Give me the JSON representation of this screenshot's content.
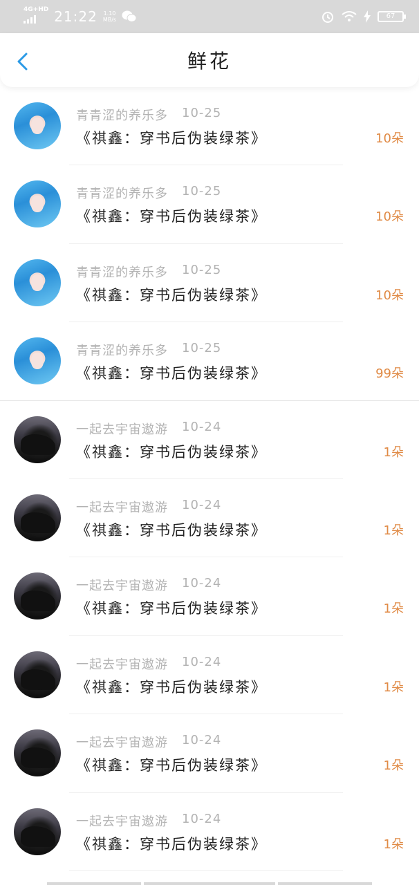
{
  "status_bar": {
    "network": "4G+HD",
    "time": "21:22",
    "speed_value": "1.10",
    "speed_unit": "MB/s",
    "battery": "67"
  },
  "header": {
    "title": "鲜花"
  },
  "rows": [
    {
      "name": "青青涩的养乐多",
      "date": "10-25",
      "book": "《祺鑫：穿书后伪装绿茶》",
      "count": "10朵",
      "avatar": "girl-blue-hair"
    },
    {
      "name": "青青涩的养乐多",
      "date": "10-25",
      "book": "《祺鑫：穿书后伪装绿茶》",
      "count": "10朵",
      "avatar": "girl-blue-hair"
    },
    {
      "name": "青青涩的养乐多",
      "date": "10-25",
      "book": "《祺鑫：穿书后伪装绿茶》",
      "count": "10朵",
      "avatar": "girl-blue-hair"
    },
    {
      "name": "青青涩的养乐多",
      "date": "10-25",
      "book": "《祺鑫：穿书后伪装绿茶》",
      "count": "99朵",
      "avatar": "girl-blue-hair"
    },
    {
      "name": "一起去宇宙遨游",
      "date": "10-24",
      "book": "《祺鑫：穿书后伪装绿茶》",
      "count": "1朵",
      "avatar": "dark-tree"
    },
    {
      "name": "一起去宇宙遨游",
      "date": "10-24",
      "book": "《祺鑫：穿书后伪装绿茶》",
      "count": "1朵",
      "avatar": "dark-tree"
    },
    {
      "name": "一起去宇宙遨游",
      "date": "10-24",
      "book": "《祺鑫：穿书后伪装绿茶》",
      "count": "1朵",
      "avatar": "dark-tree"
    },
    {
      "name": "一起去宇宙遨游",
      "date": "10-24",
      "book": "《祺鑫：穿书后伪装绿茶》",
      "count": "1朵",
      "avatar": "dark-tree"
    },
    {
      "name": "一起去宇宙遨游",
      "date": "10-24",
      "book": "《祺鑫：穿书后伪装绿茶》",
      "count": "1朵",
      "avatar": "dark-tree"
    },
    {
      "name": "一起去宇宙遨游",
      "date": "10-24",
      "book": "《祺鑫：穿书后伪装绿茶》",
      "count": "1朵",
      "avatar": "dark-tree"
    }
  ],
  "colors": {
    "accent": "#2b9ae6",
    "count": "#e08a45",
    "muted": "#b3b3b3"
  }
}
